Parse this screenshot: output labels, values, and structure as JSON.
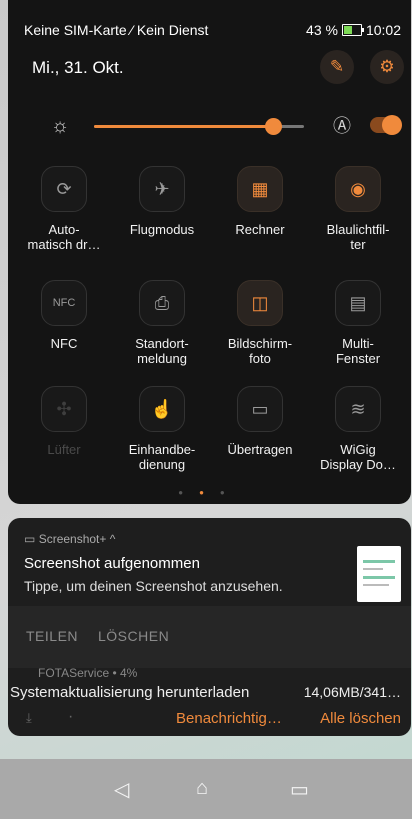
{
  "status": {
    "carrier": "Keine SIM-Karte ⁄ Kein Dienst",
    "battery": "43 %",
    "time": "10:02"
  },
  "header": {
    "date": "Mi., 31. Okt.",
    "edit_icon": "edit-icon",
    "settings_icon": "gear-icon"
  },
  "brightness": {
    "level": 0.85,
    "auto_enabled": true
  },
  "tiles": [
    {
      "label": "Auto-\nmatisch dr…",
      "icon": "auto-rotate-icon",
      "active": false,
      "disabled": false
    },
    {
      "label": "Flugmodus",
      "icon": "airplane-icon",
      "active": false,
      "disabled": false
    },
    {
      "label": "Rechner",
      "icon": "calculator-icon",
      "active": true,
      "disabled": false
    },
    {
      "label": "Blaulichtfil-\nter",
      "icon": "eye-shield-icon",
      "active": true,
      "disabled": false
    },
    {
      "label": "NFC",
      "icon": "nfc-icon",
      "active": false,
      "disabled": false
    },
    {
      "label": "Standort-\nmeldung",
      "icon": "location-doc-icon",
      "active": false,
      "disabled": false
    },
    {
      "label": "Bildschirm-\nfoto",
      "icon": "screenshot-camera-icon",
      "active": true,
      "disabled": false
    },
    {
      "label": "Multi-\nFenster",
      "icon": "multi-window-icon",
      "active": false,
      "disabled": false
    },
    {
      "label": "Lüfter",
      "icon": "fan-icon",
      "active": false,
      "disabled": true
    },
    {
      "label": "Einhandbe-\ndienung",
      "icon": "one-hand-icon",
      "active": false,
      "disabled": false
    },
    {
      "label": "Übertragen",
      "icon": "cast-icon",
      "active": false,
      "disabled": false
    },
    {
      "label": "WiGig\nDisplay Do…",
      "icon": "wigig-icon",
      "active": false,
      "disabled": false
    }
  ],
  "notification": {
    "app": "Screenshot+ ^",
    "title": "Screenshot aufgenommen",
    "text": "Tippe, um deinen Screenshot anzusehen.",
    "action_share": "TEILEN",
    "action_delete": "LÖSCHEN",
    "fota_app": "FOTAService • 4%",
    "fota_title": "Systemaktualisierung herunterladen",
    "fota_size": "14,06MB/341…",
    "btn_notify": "Benachrichtig…",
    "btn_clear_all": "Alle löschen"
  },
  "colors": {
    "accent": "#f08a3c",
    "panel": "#141414",
    "card": "#1e1e1e"
  }
}
